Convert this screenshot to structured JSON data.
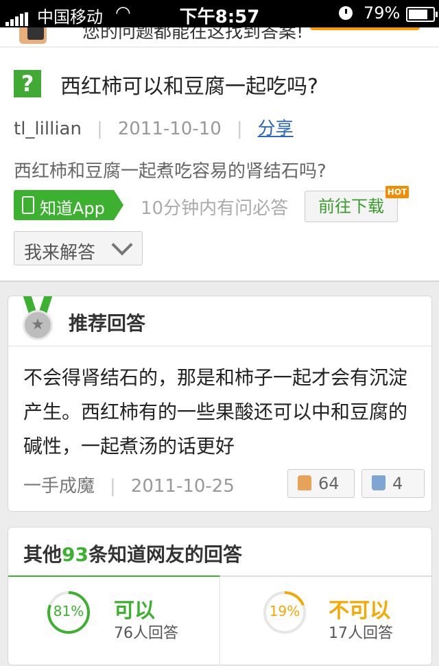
{
  "status_bar": {
    "carrier": "中国移动",
    "time": "下午8:57",
    "battery": "79%",
    "battery_level": 0.79
  },
  "banner": {
    "text": "您的问题都能在这找到答案!"
  },
  "question": {
    "icon": "?",
    "title": "西红柿可以和豆腐一起吃吗?",
    "author": "tl_lillian",
    "date": "2011-10-10",
    "share_label": "分享",
    "description": "西红柿和豆腐一起煮吃容易的肾结石吗?",
    "app_button_label": "知道App",
    "app_slogan": "10分钟内有问必答",
    "download_label": "前往下载",
    "hot_badge": "HOT",
    "answer_button_label": "我来解答"
  },
  "recommended": {
    "title": "推荐回答",
    "body": "不会得肾结石的，那是和柿子一起才会有沉淀产生。西红柿有的一些果酸还可以中和豆腐的碱性，一起煮汤的话更好",
    "author": "一手成魔",
    "date": "2011-10-25",
    "upvotes": "64",
    "downvotes": "4"
  },
  "others": {
    "title_prefix": "其他",
    "count": "93",
    "title_suffix": "条知道网友的回答",
    "yes": {
      "percent_label": "81%",
      "percent": 81,
      "label": "可以",
      "count_label": "76人回答",
      "color": "#3cb02f"
    },
    "no": {
      "percent_label": "19%",
      "percent": 19,
      "label": "不可以",
      "count_label": "17人回答",
      "color": "#f5a800"
    }
  },
  "colors": {
    "accent_green": "#3cb02f",
    "accent_orange": "#f5a800",
    "link_blue": "#2b67c3"
  }
}
